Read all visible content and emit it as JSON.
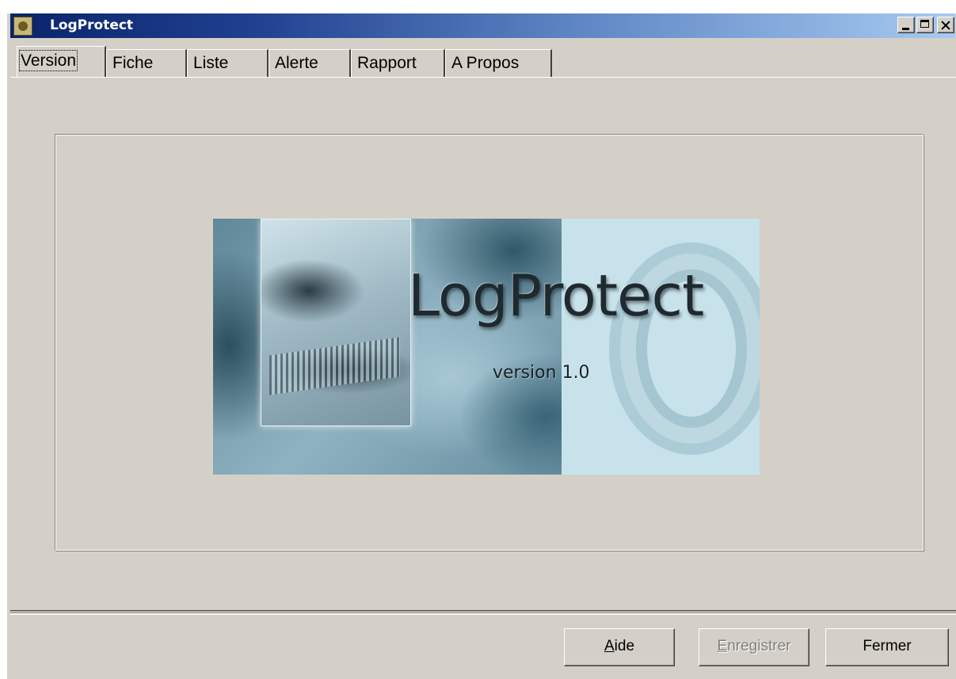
{
  "window": {
    "title": "LogProtect",
    "controls": {
      "minimize": "minimize",
      "maximize": "maximize",
      "close": "close"
    }
  },
  "tabs": [
    {
      "label": "Version",
      "active": true
    },
    {
      "label": "Fiche",
      "active": false
    },
    {
      "label": "Liste",
      "active": false
    },
    {
      "label": "Alerte",
      "active": false
    },
    {
      "label": "Rapport",
      "active": false
    },
    {
      "label": "A Propos",
      "active": false
    }
  ],
  "splash": {
    "title": "LogProtect",
    "version": "version 1.0"
  },
  "buttons": {
    "help": {
      "mnemonic": "A",
      "rest": "ide",
      "enabled": true
    },
    "save": {
      "mnemonic": "E",
      "rest": "nregistrer",
      "enabled": false
    },
    "close": {
      "label": "Fermer",
      "enabled": true
    }
  },
  "colors": {
    "face": "#d4d0c8",
    "titlebar_start": "#0a246a",
    "titlebar_end": "#a6caf0"
  },
  "icons": {
    "app": "logprotect-app-icon",
    "minimize": "minimize-icon",
    "maximize": "maximize-icon",
    "close": "close-icon"
  }
}
